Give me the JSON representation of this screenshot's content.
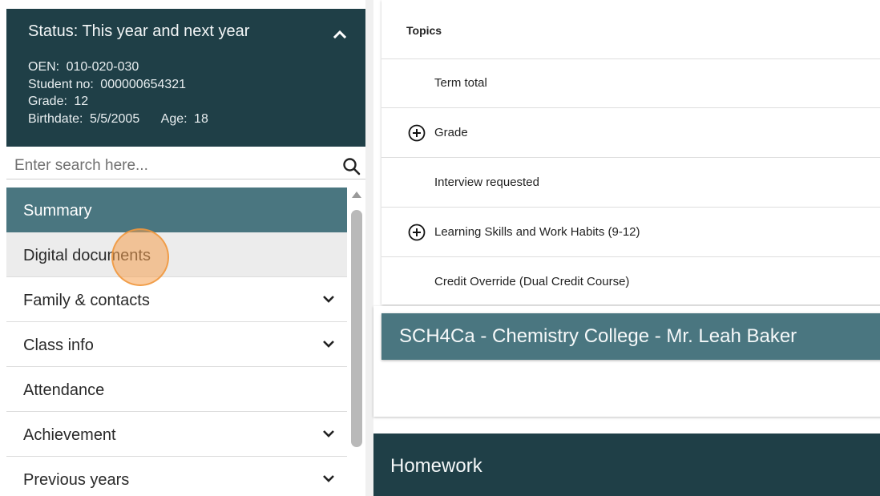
{
  "status": {
    "title": "Status: This year and next year",
    "oen_label": "OEN:",
    "oen_value": "010-020-030",
    "student_no_label": "Student no:",
    "student_no_value": "000000654321",
    "grade_label": "Grade:",
    "grade_value": "12",
    "birthdate_label": "Birthdate:",
    "birthdate_value": "5/5/2005",
    "age_label": "Age:",
    "age_value": "18"
  },
  "search": {
    "placeholder": "Enter search here..."
  },
  "nav": {
    "items": [
      {
        "label": "Summary"
      },
      {
        "label": "Digital documents"
      },
      {
        "label": "Family & contacts"
      },
      {
        "label": "Class info"
      },
      {
        "label": "Attendance"
      },
      {
        "label": "Achievement"
      },
      {
        "label": "Previous years"
      }
    ]
  },
  "topics": {
    "header": "Topics",
    "rows": [
      {
        "label": "Term total"
      },
      {
        "label": "Grade"
      },
      {
        "label": "Interview requested"
      },
      {
        "label": "Learning Skills and Work Habits (9-12)"
      },
      {
        "label": "Credit Override (Dual Credit Course)"
      }
    ]
  },
  "course": {
    "title": "SCH4Ca - Chemistry College - Mr. Leah Baker"
  },
  "homework": {
    "title": "Homework"
  },
  "colors": {
    "dark_teal": "#1f3f47",
    "accent_teal": "#4a7680",
    "click_highlight": "#f5a050"
  },
  "icons": {
    "collapse": "chevron-up-icon",
    "search": "search-icon",
    "expand": "chevron-down-icon",
    "add": "plus-circle-icon"
  }
}
